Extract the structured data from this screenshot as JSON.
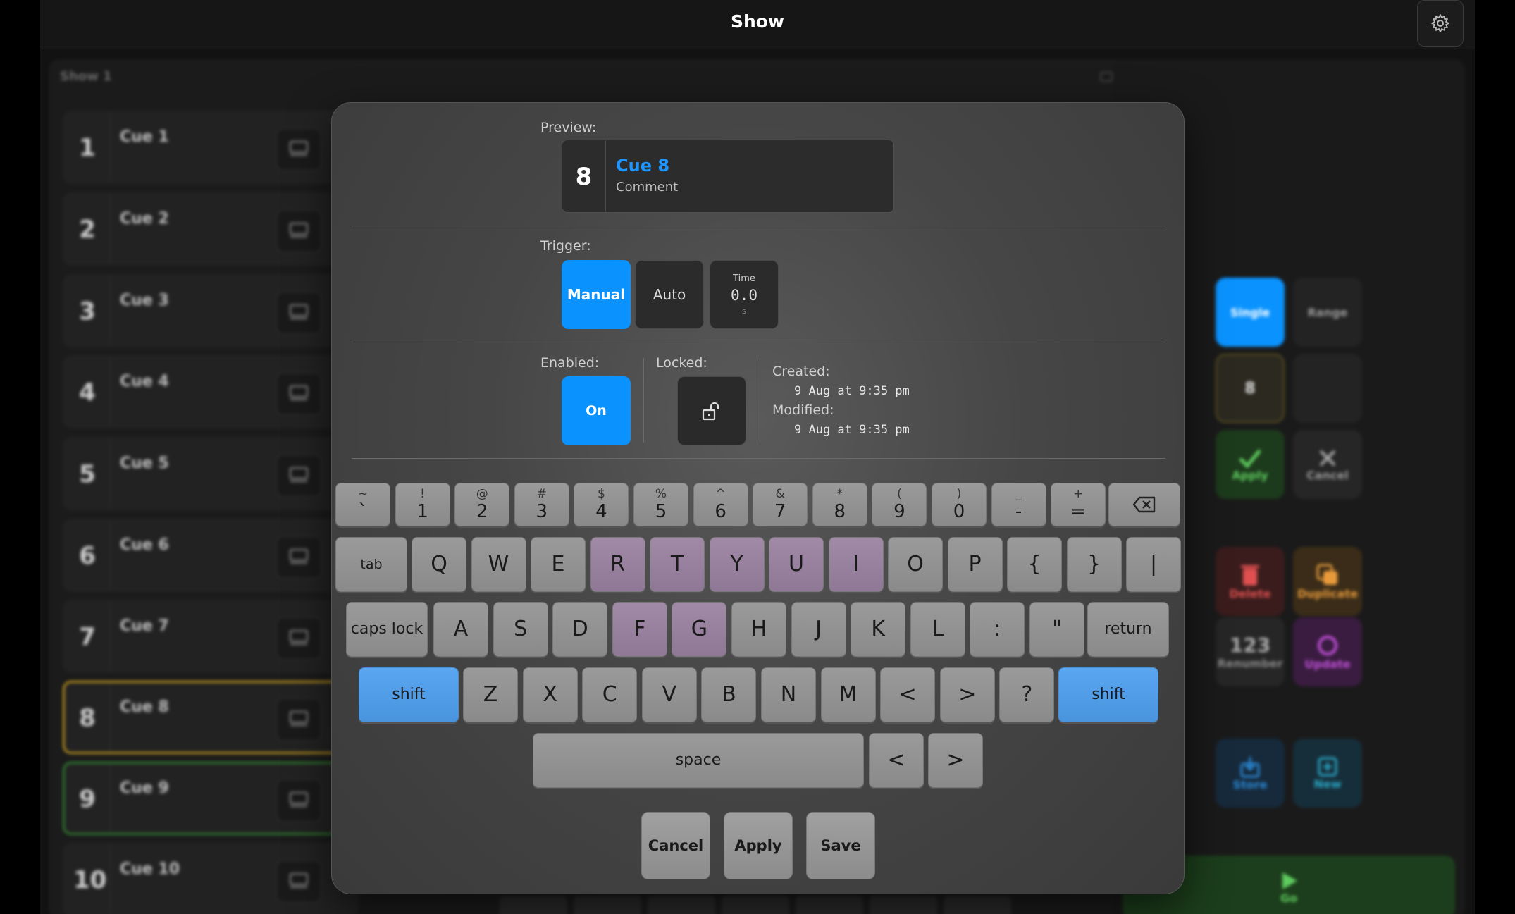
{
  "app": {
    "title": "Show"
  },
  "background": {
    "panel_title": "Show 1",
    "cues": [
      {
        "number": "1",
        "name": "Cue 1"
      },
      {
        "number": "2",
        "name": "Cue 2"
      },
      {
        "number": "3",
        "name": "Cue 3"
      },
      {
        "number": "4",
        "name": "Cue 4"
      },
      {
        "number": "5",
        "name": "Cue 5"
      },
      {
        "number": "6",
        "name": "Cue 6"
      },
      {
        "number": "7",
        "name": "Cue 7"
      },
      {
        "number": "8",
        "name": "Cue 8"
      },
      {
        "number": "9",
        "name": "Cue 9"
      },
      {
        "number": "10",
        "name": "Cue 10"
      }
    ],
    "right": {
      "single": "Single",
      "range": "Range",
      "cue_value": "8",
      "apply": "Apply",
      "cancel": "Cancel",
      "delete": "Delete",
      "duplicate": "Duplicate",
      "renumber_glyph": "123",
      "renumber": "Renumber",
      "update": "Update",
      "store": "Store",
      "new": "New",
      "go": "Go"
    }
  },
  "dialog": {
    "preview_label": "Preview:",
    "preview_number": "8",
    "preview_name": "Cue 8",
    "preview_comment": "Comment",
    "trigger_label": "Trigger:",
    "trigger_manual": "Manual",
    "trigger_auto": "Auto",
    "time_label": "Time",
    "time_value": "0.0",
    "time_unit": "s",
    "enabled_label": "Enabled:",
    "enabled_value": "On",
    "locked_label": "Locked:",
    "created_label": "Created:",
    "created_value": "9 Aug at 9:35 pm",
    "modified_label": "Modified:",
    "modified_value": "9 Aug at 9:35 pm",
    "cancel": "Cancel",
    "apply": "Apply",
    "save": "Save"
  },
  "keyboard": {
    "row1": [
      {
        "sym": "~",
        "main": "`"
      },
      {
        "sym": "!",
        "main": "1"
      },
      {
        "sym": "@",
        "main": "2"
      },
      {
        "sym": "#",
        "main": "3"
      },
      {
        "sym": "$",
        "main": "4"
      },
      {
        "sym": "%",
        "main": "5"
      },
      {
        "sym": "^",
        "main": "6"
      },
      {
        "sym": "&",
        "main": "7"
      },
      {
        "sym": "*",
        "main": "8"
      },
      {
        "sym": "(",
        "main": "9"
      },
      {
        "sym": ")",
        "main": "0"
      },
      {
        "sym": "_",
        "main": "-"
      },
      {
        "sym": "+",
        "main": "="
      }
    ],
    "tab": "tab",
    "row2": [
      "Q",
      "W",
      "E",
      "R",
      "T",
      "Y",
      "U",
      "I",
      "O",
      "P",
      "{",
      "}",
      "|"
    ],
    "caps": "caps lock",
    "row3": [
      "A",
      "S",
      "D",
      "F",
      "G",
      "H",
      "J",
      "K",
      "L",
      ":",
      "\""
    ],
    "return": "return",
    "shift": "shift",
    "row4": [
      "Z",
      "X",
      "C",
      "V",
      "B",
      "N",
      "M",
      "<",
      ">",
      "?"
    ],
    "space": "space",
    "left": "<",
    "right": ">"
  }
}
